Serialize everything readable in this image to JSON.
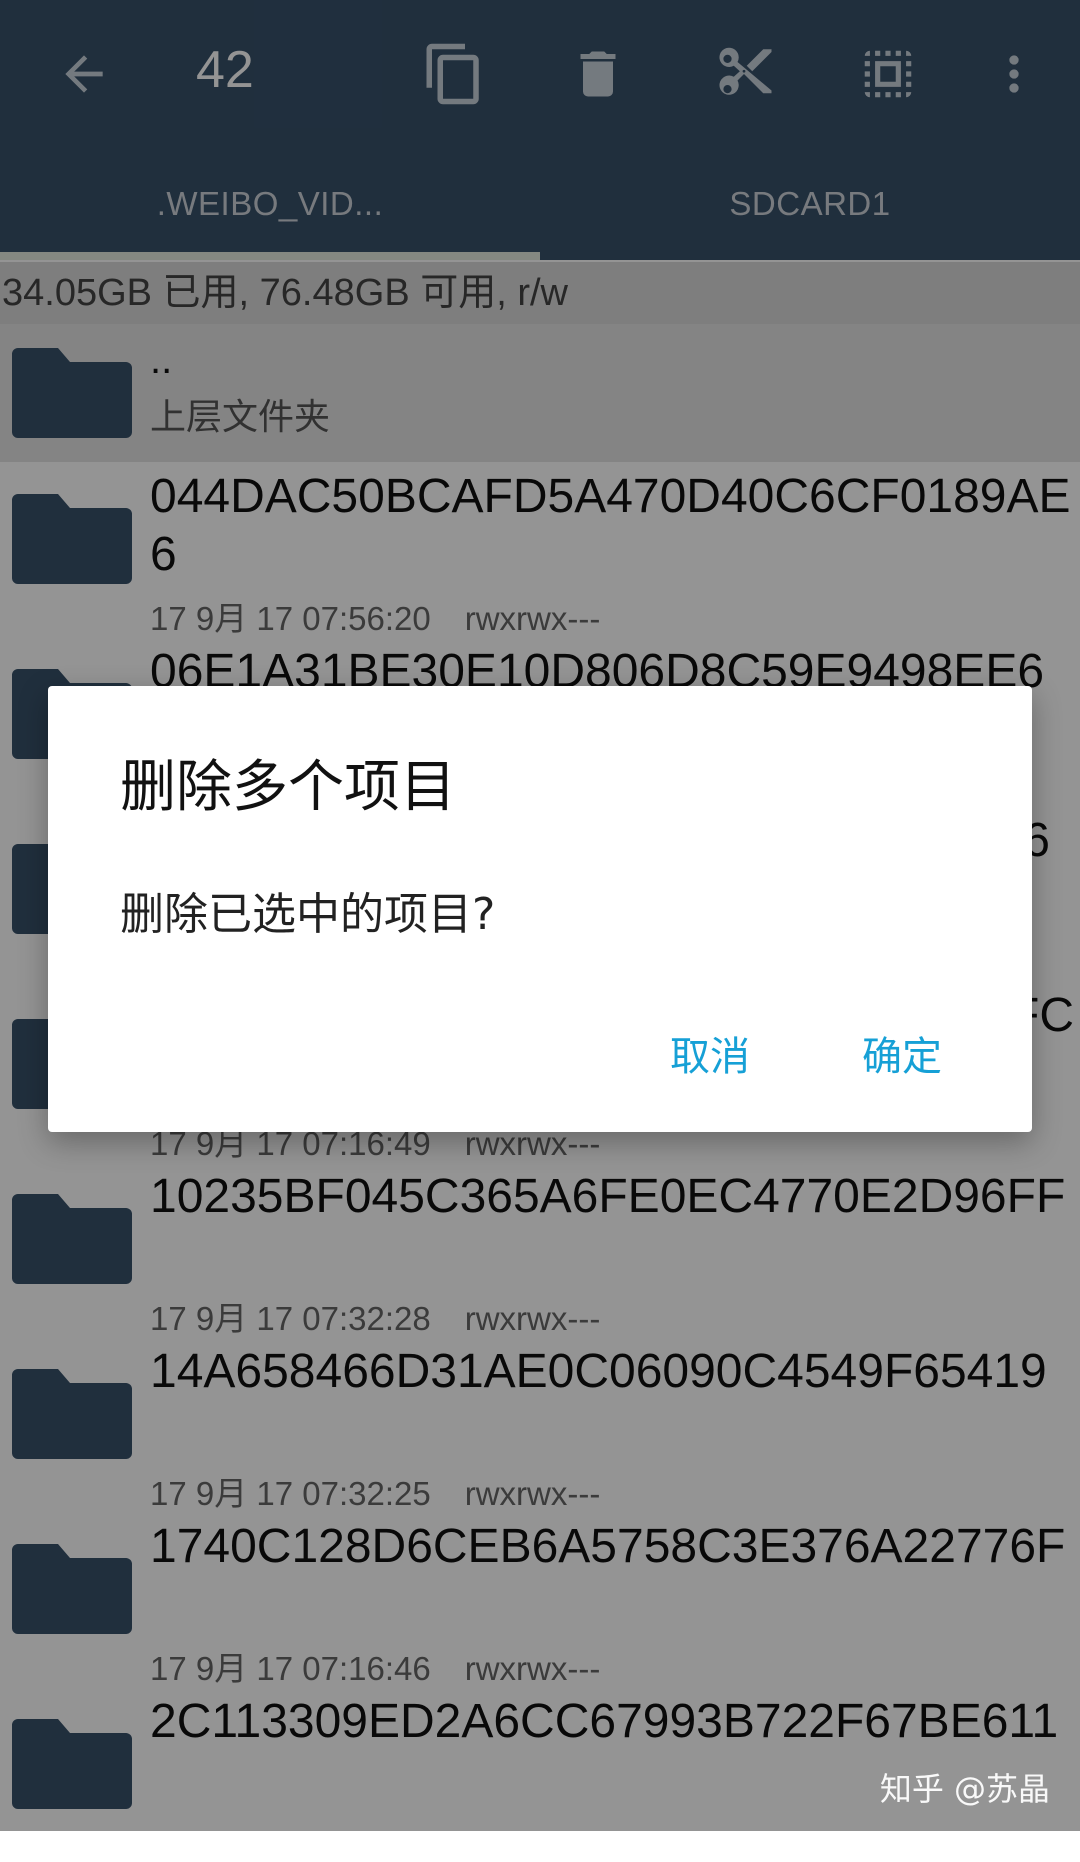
{
  "toolbar": {
    "selected_count": "42",
    "icons": [
      "back-arrow-icon",
      "copy-icon",
      "trash-icon",
      "cut-scissors-icon",
      "select-all-icon",
      "more-vert-icon"
    ]
  },
  "tabs": [
    ".WEIBO_VID...",
    "SDCARD1"
  ],
  "storage_info": "34.05GB 已用, 76.48GB 可用, r/w",
  "parent": {
    "name": "..",
    "label": "上层文件夹"
  },
  "files": [
    {
      "name": "044DAC50BCAFD5A470D40C6CF0189AE6",
      "date": "17 9月 17 07:56:20",
      "perm": "rwxrwx---"
    },
    {
      "name": "06E1A31BE30E10D806D8C59E9498EE6",
      "date": "",
      "perm": ""
    },
    {
      "name": "6",
      "date": "",
      "perm": ""
    },
    {
      "name": "FC",
      "date": "17 9月 17 07:16:49",
      "perm": "rwxrwx---"
    },
    {
      "name": "10235BF045C365A6FE0EC4770E2D96FF",
      "date": "17 9月 17 07:32:28",
      "perm": "rwxrwx---"
    },
    {
      "name": "14A658466D31AE0C06090C4549F65419",
      "date": "17 9月 17 07:32:25",
      "perm": "rwxrwx---"
    },
    {
      "name": "1740C128D6CEB6A5758C3E376A22776F",
      "date": "17 9月 17 07:16:46",
      "perm": "rwxrwx---"
    },
    {
      "name": "2C113309ED2A6CC67993B722F67BE611",
      "date": "",
      "perm": ""
    }
  ],
  "dialog": {
    "title": "删除多个项目",
    "message": "删除已选中的项目?",
    "cancel": "取消",
    "confirm": "确定"
  },
  "watermark": "知乎 @苏晶",
  "colors": {
    "toolbar": "#37516a",
    "folder": "#37516a",
    "accent": "#16a0d6"
  }
}
